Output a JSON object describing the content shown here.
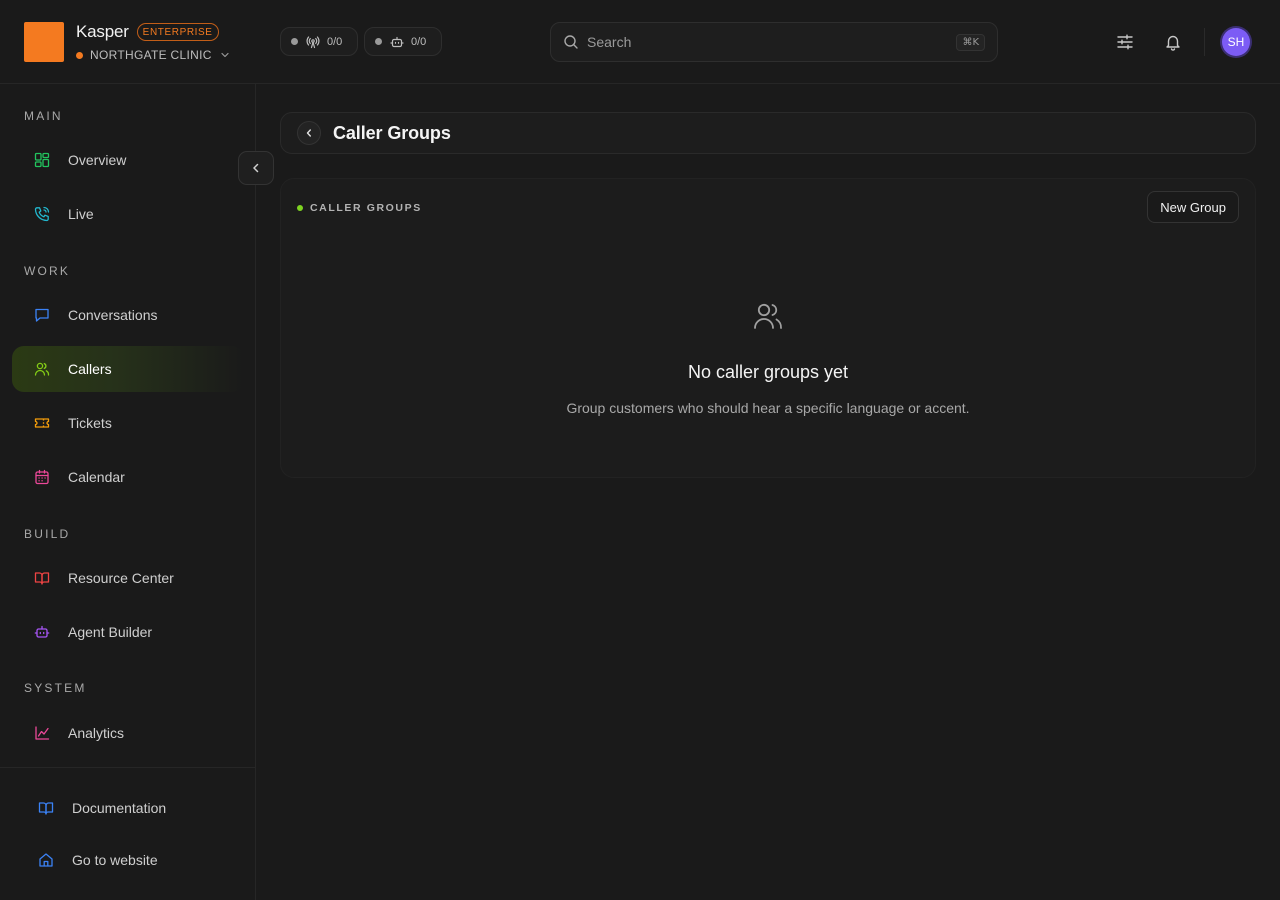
{
  "app": {
    "name": "Kasper",
    "plan_badge": "ENTERPRISE",
    "org_name": "NORTHGATE CLINIC"
  },
  "status": {
    "calls_count": "0/0",
    "agents_count": "0/0"
  },
  "search": {
    "placeholder": "Search",
    "shortcut": "⌘K"
  },
  "user": {
    "initials": "SH"
  },
  "sidebar": {
    "sections": [
      {
        "title": "MAIN"
      },
      {
        "title": "WORK"
      },
      {
        "title": "BUILD"
      },
      {
        "title": "SYSTEM"
      }
    ],
    "items": [
      {
        "label": "Overview",
        "icon": "grid-icon",
        "color": "#22c55e"
      },
      {
        "label": "Live",
        "icon": "phone-icon",
        "color": "#22b8cf"
      },
      {
        "label": "Conversations",
        "icon": "chat-icon",
        "color": "#3b82f6"
      },
      {
        "label": "Callers",
        "icon": "users-icon",
        "color": "#84cc16",
        "active": true
      },
      {
        "label": "Tickets",
        "icon": "ticket-icon",
        "color": "#f59e0b"
      },
      {
        "label": "Calendar",
        "icon": "calendar-icon",
        "color": "#ec4899"
      },
      {
        "label": "Resource Center",
        "icon": "book-icon",
        "color": "#ef4444"
      },
      {
        "label": "Agent Builder",
        "icon": "bot-icon",
        "color": "#a855f7"
      },
      {
        "label": "Analytics",
        "icon": "chart-icon",
        "color": "#ec4899"
      }
    ],
    "footer": [
      {
        "label": "Documentation",
        "icon": "book-open-icon",
        "color": "#3b82f6"
      },
      {
        "label": "Go to website",
        "icon": "home-icon",
        "color": "#3b82f6"
      }
    ]
  },
  "page": {
    "title": "Caller Groups"
  },
  "card": {
    "label": "CALLER GROUPS",
    "new_button": "New Group",
    "empty_title": "No caller groups yet",
    "empty_subtitle": "Group customers who should hear a specific language or accent."
  }
}
